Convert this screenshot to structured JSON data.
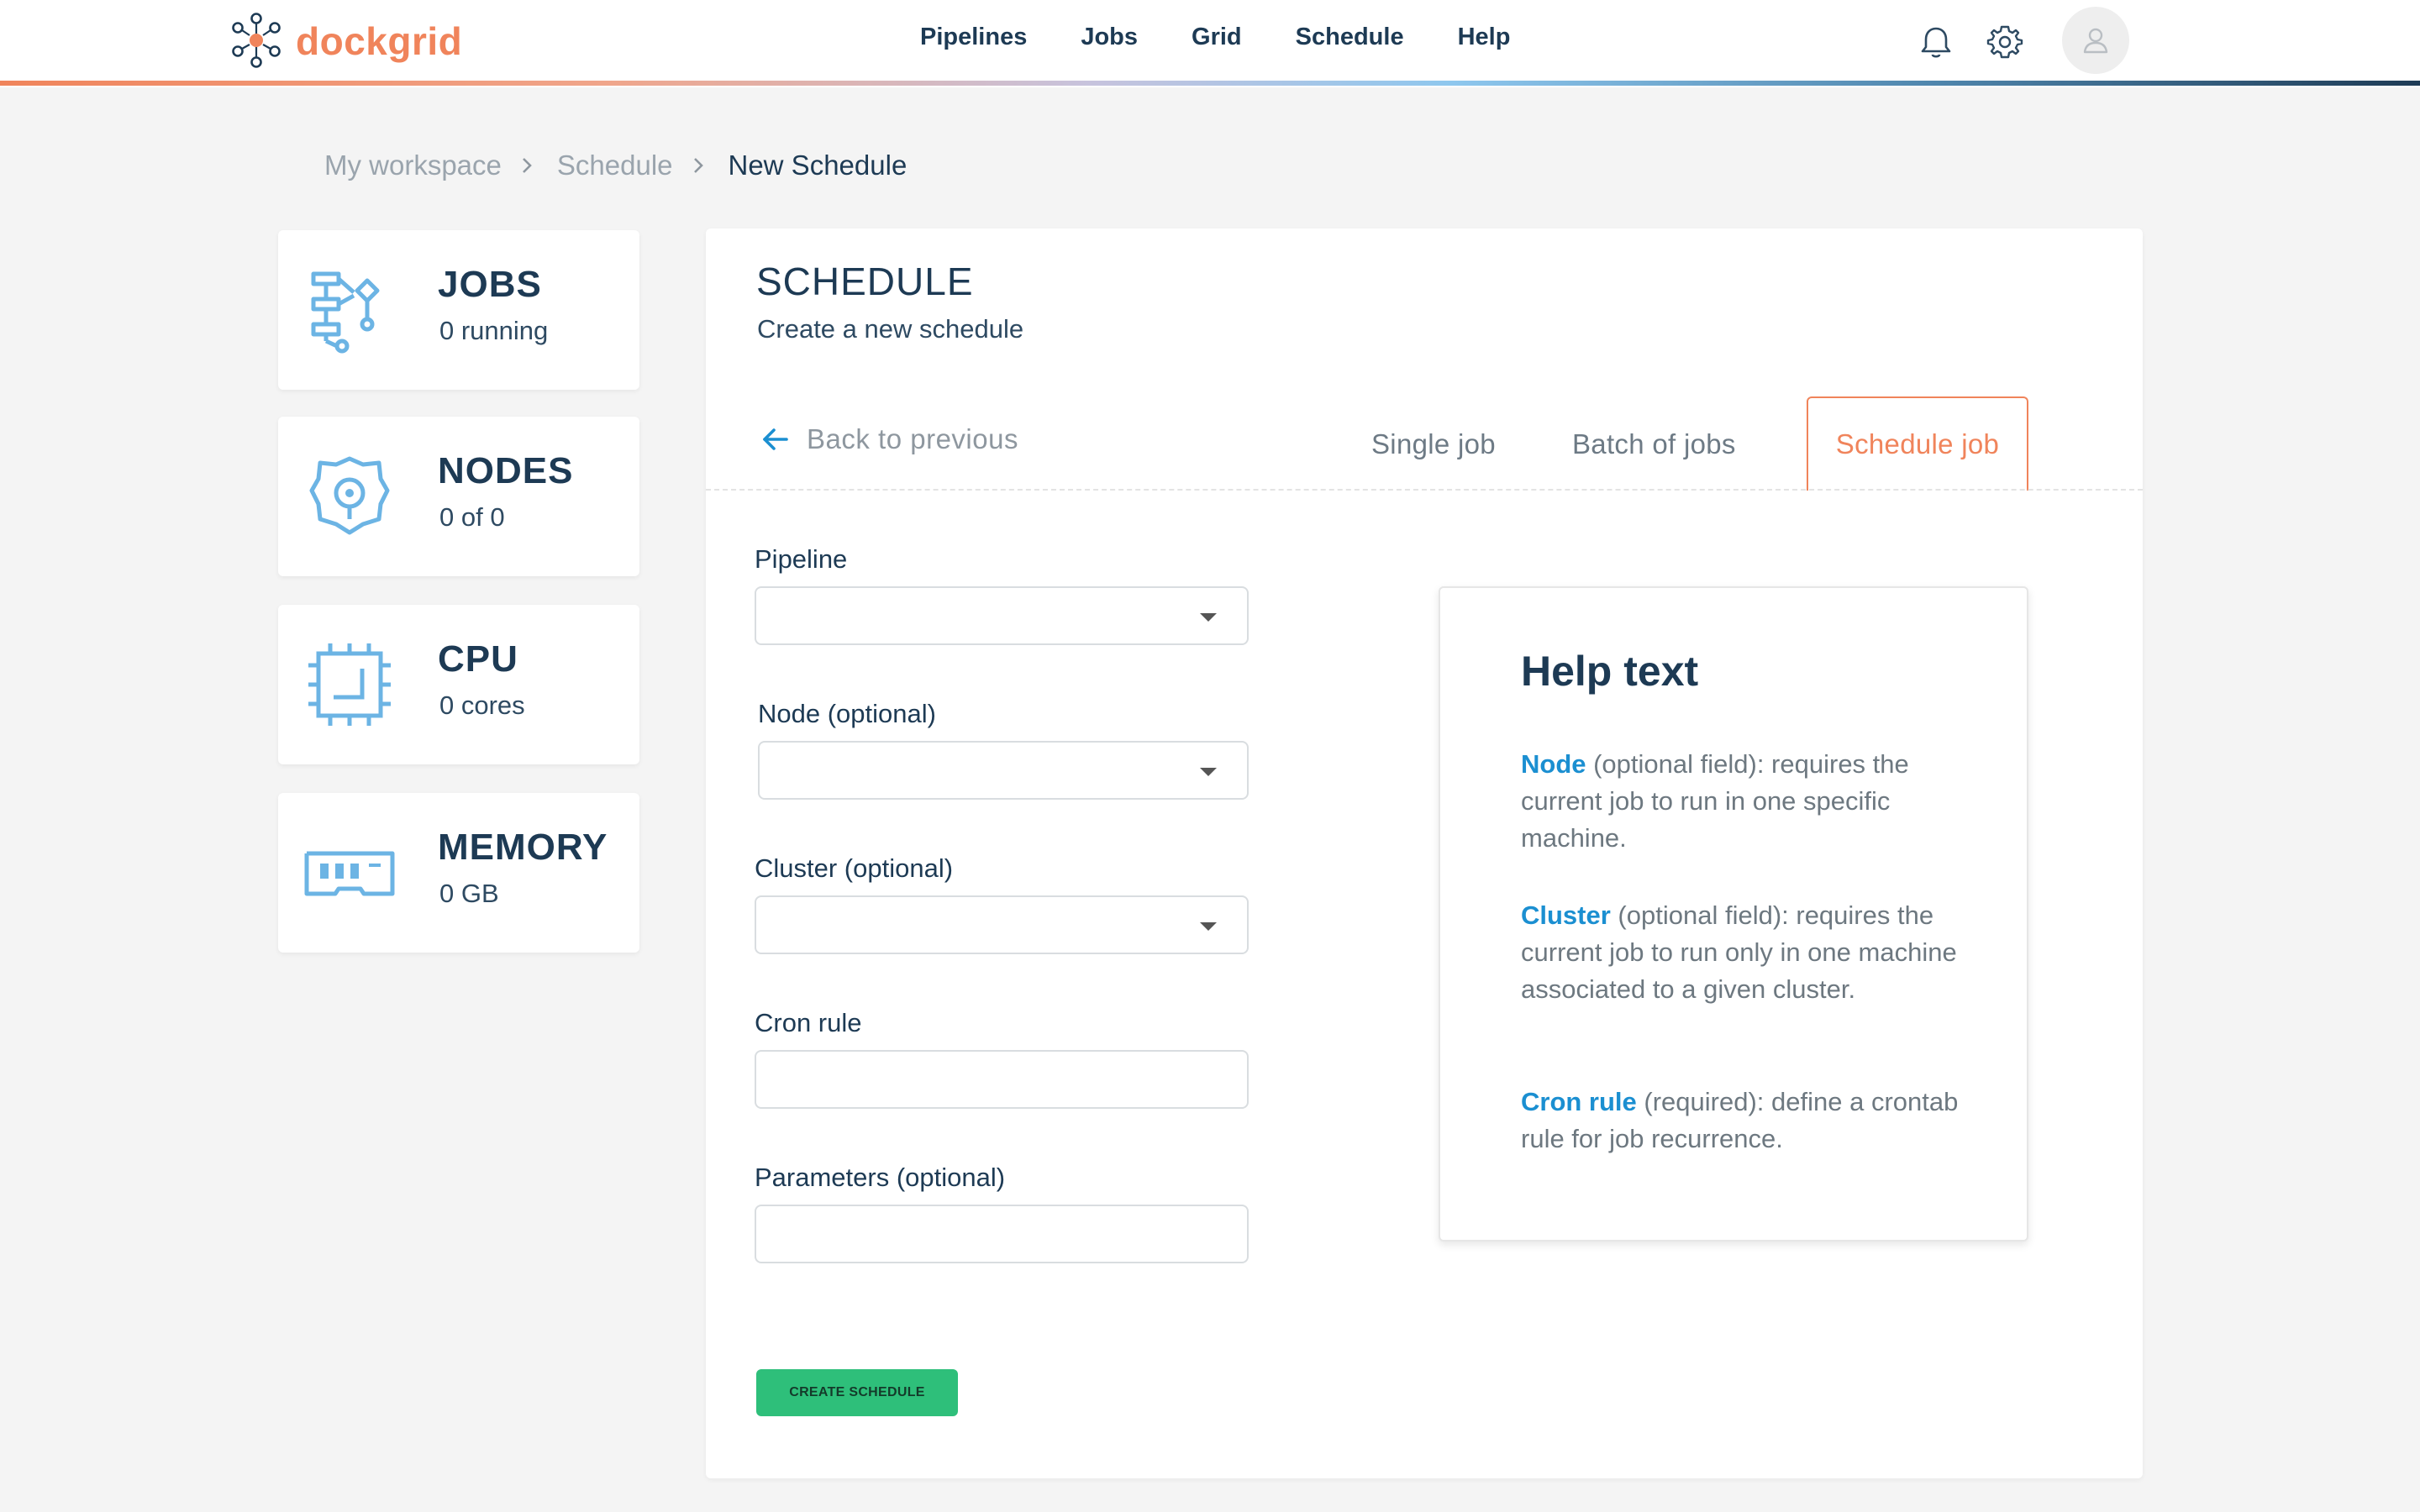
{
  "app": {
    "name": "dockgrid",
    "brand_color": "#f0845b"
  },
  "nav": {
    "items": [
      "Pipelines",
      "Jobs",
      "Grid",
      "Schedule",
      "Help"
    ]
  },
  "header_icons": [
    "bell-icon",
    "gear-icon",
    "user-avatar-icon"
  ],
  "breadcrumb": {
    "items": [
      "My workspace",
      "Schedule"
    ],
    "current": "New Schedule"
  },
  "stats": {
    "jobs": {
      "title": "JOBS",
      "value": "0 running",
      "icon": "workflow-icon"
    },
    "nodes": {
      "title": "NODES",
      "value": "0 of 0",
      "icon": "node-gear-icon"
    },
    "cpu": {
      "title": "CPU",
      "value": "0 cores",
      "icon": "cpu-chip-icon"
    },
    "memory": {
      "title": "MEMORY",
      "value": "0 GB",
      "icon": "memory-module-icon"
    }
  },
  "panel": {
    "title": "SCHEDULE",
    "subtitle": "Create a new schedule",
    "back_label": "Back to previous",
    "tabs": {
      "single": "Single job",
      "batch": "Batch of jobs",
      "schedule": "Schedule job"
    },
    "active_tab": "Schedule job",
    "active_color": "#f0845b"
  },
  "form": {
    "pipeline": {
      "label": "Pipeline",
      "value": ""
    },
    "node": {
      "label": "Node (optional)",
      "value": ""
    },
    "cluster": {
      "label": "Cluster (optional)",
      "value": ""
    },
    "cron": {
      "label": "Cron rule",
      "value": ""
    },
    "params": {
      "label": "Parameters (optional)",
      "value": ""
    },
    "submit_label": "CREATE SCHEDULE",
    "submit_color": "#2ebf7a"
  },
  "help": {
    "title": "Help text",
    "node_key": "Node",
    "node_text": " (optional field): requires the current job to run in one specific machine.",
    "cluster_key": "Cluster",
    "cluster_text": " (optional field): requires the current job to run only in one machine associated to a given cluster.",
    "cron_key": "Cron rule",
    "cron_text": " (required): define a crontab rule for job recurrence.",
    "key_color": "#1b8fd1"
  }
}
